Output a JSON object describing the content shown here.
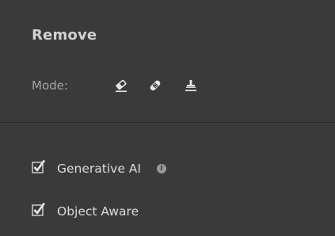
{
  "panel": {
    "title": "Remove"
  },
  "mode": {
    "label": "Mode:",
    "tools": [
      {
        "icon": "eraser-icon",
        "selected": true
      },
      {
        "icon": "bandage-icon",
        "selected": false
      },
      {
        "icon": "clone-stamp-icon",
        "selected": false
      }
    ]
  },
  "options": [
    {
      "label": "Generative AI",
      "checked": true,
      "has_info": true,
      "info_glyph": "i"
    },
    {
      "label": "Object Aware",
      "checked": true,
      "has_info": false
    }
  ],
  "colors": {
    "background": "#3a3a3a",
    "title": "#d2d2d2",
    "label_muted": "#a4a4a4",
    "text": "#dcdcdc",
    "icon": "#e0e0e0"
  }
}
